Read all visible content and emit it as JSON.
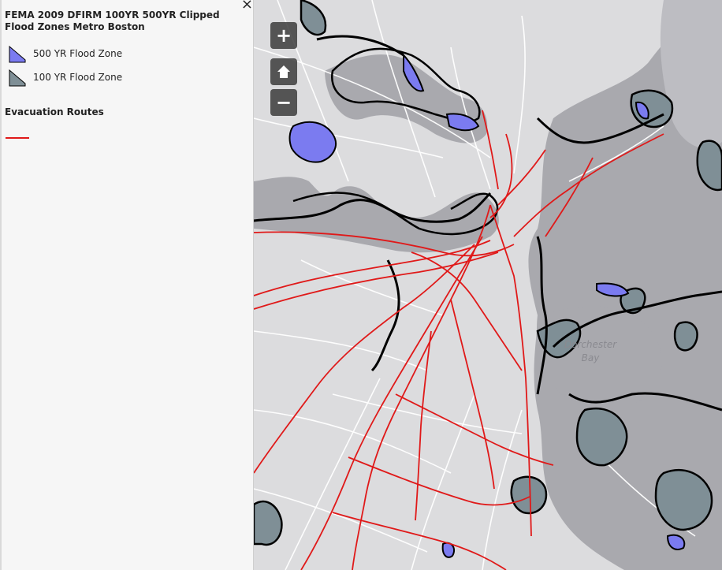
{
  "legend": {
    "close_label": "×",
    "layer_title": "FEMA 2009 DFIRM 100YR 500YR Clipped Flood Zones Metro Boston",
    "items": [
      {
        "label": "500 YR Flood Zone",
        "color": "#7b7bf0"
      },
      {
        "label": "100 YR Flood Zone",
        "color": "#7f8f96"
      }
    ],
    "evacuation_title": "Evacuation Routes",
    "evacuation_color": "#e01919"
  },
  "map": {
    "controls": {
      "zoom_in": "+",
      "home": "home-icon",
      "zoom_out": "−"
    },
    "place_labels": {
      "dorchester_line1": "Dorchester",
      "dorchester_line2": "Bay"
    },
    "colors": {
      "land": "#dcdcde",
      "water": "#a9a9ae",
      "flood_100": "#7f8f96",
      "flood_500": "#7b7bf0",
      "route": "#e01919",
      "roads": "#ffffff"
    }
  }
}
